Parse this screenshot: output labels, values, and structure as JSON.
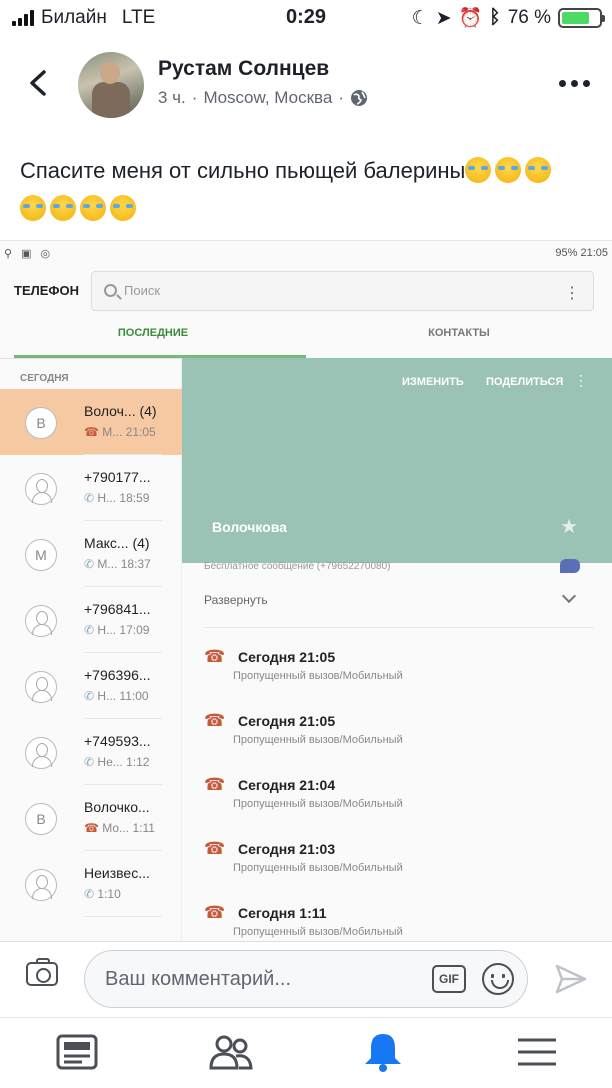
{
  "status_bar": {
    "carrier": "Билайн",
    "network": "LTE",
    "time": "0:29",
    "battery": "76 %",
    "battery_level": 0.76
  },
  "post": {
    "author": "Рустам Солнцев",
    "time_ago": "3 ч.",
    "location": "Moscow, Москва",
    "text": "Спасите меня от сильно пьющей балерины"
  },
  "phone_app": {
    "status_bar_right": "95% 21:05",
    "title": "ТЕЛЕФОН",
    "search_placeholder": "Поиск",
    "tabs": [
      {
        "label": "ПОСЛЕДНИЕ",
        "active": true
      },
      {
        "label": "КОНТАКТЫ",
        "active": false
      }
    ],
    "section_today": "СЕГОДНЯ",
    "recent": [
      {
        "avatar": "В",
        "name": "Волоч...",
        "count": "(4)",
        "type": "М...",
        "time": "21:05",
        "missed": true,
        "selected": true
      },
      {
        "avatar": "",
        "name": "+790177...",
        "count": "",
        "type": "Н...",
        "time": "18:59",
        "missed": false,
        "selected": false
      },
      {
        "avatar": "М",
        "name": "Макс...",
        "count": "(4)",
        "type": "М...",
        "time": "18:37",
        "missed": false,
        "selected": false
      },
      {
        "avatar": "",
        "name": "+796841...",
        "count": "",
        "type": "Н...",
        "time": "17:09",
        "missed": false,
        "selected": false
      },
      {
        "avatar": "",
        "name": "+796396...",
        "count": "",
        "type": "Н...",
        "time": "11:00",
        "missed": false,
        "selected": false
      },
      {
        "avatar": "",
        "name": "+749593...",
        "count": "",
        "type": "Не...",
        "time": "1:12",
        "missed": false,
        "selected": false
      },
      {
        "avatar": "В",
        "name": "Волочко...",
        "count": "",
        "type": "Мо...",
        "time": "1:11",
        "missed": true,
        "selected": false
      },
      {
        "avatar": "",
        "name": "Неизвес...",
        "count": "",
        "type": "",
        "time": "1:10",
        "missed": false,
        "selected": false
      }
    ],
    "detail": {
      "action_edit": "ИЗМЕНИТЬ",
      "action_share": "ПОДЕЛИТЬСЯ",
      "contact_name": "Волочкова",
      "free_message": "Бесплатное сообщение (+79652270080)",
      "expand": "Развернуть",
      "calls": [
        {
          "title": "Сегодня 21:05",
          "desc": "Пропущенный вызов/Мобильный"
        },
        {
          "title": "Сегодня 21:05",
          "desc": "Пропущенный вызов/Мобильный"
        },
        {
          "title": "Сегодня 21:04",
          "desc": "Пропущенный вызов/Мобильный"
        },
        {
          "title": "Сегодня 21:03",
          "desc": "Пропущенный вызов/Мобильный"
        },
        {
          "title": "Сегодня 1:11",
          "desc": "Пропущенный вызов/Мобильный"
        }
      ]
    }
  },
  "comment_bar": {
    "placeholder": "Ваш комментарий...",
    "gif_label": "GIF"
  },
  "colors": {
    "accent_blue": "#1877f2",
    "selected_row": "#f6c9a3",
    "detail_header": "#9bc3b5",
    "active_tab": "#3a8c3a"
  },
  "icons": {
    "back": "chevron-left-icon",
    "more": "more-horizontal-icon",
    "globe": "globe-icon",
    "camera": "camera-icon",
    "gif": "gif-icon",
    "emoji": "emoji-icon",
    "send": "send-icon",
    "feed": "news-feed-icon",
    "friends": "friends-icon",
    "notifications": "bell-icon",
    "menu": "menu-icon"
  }
}
